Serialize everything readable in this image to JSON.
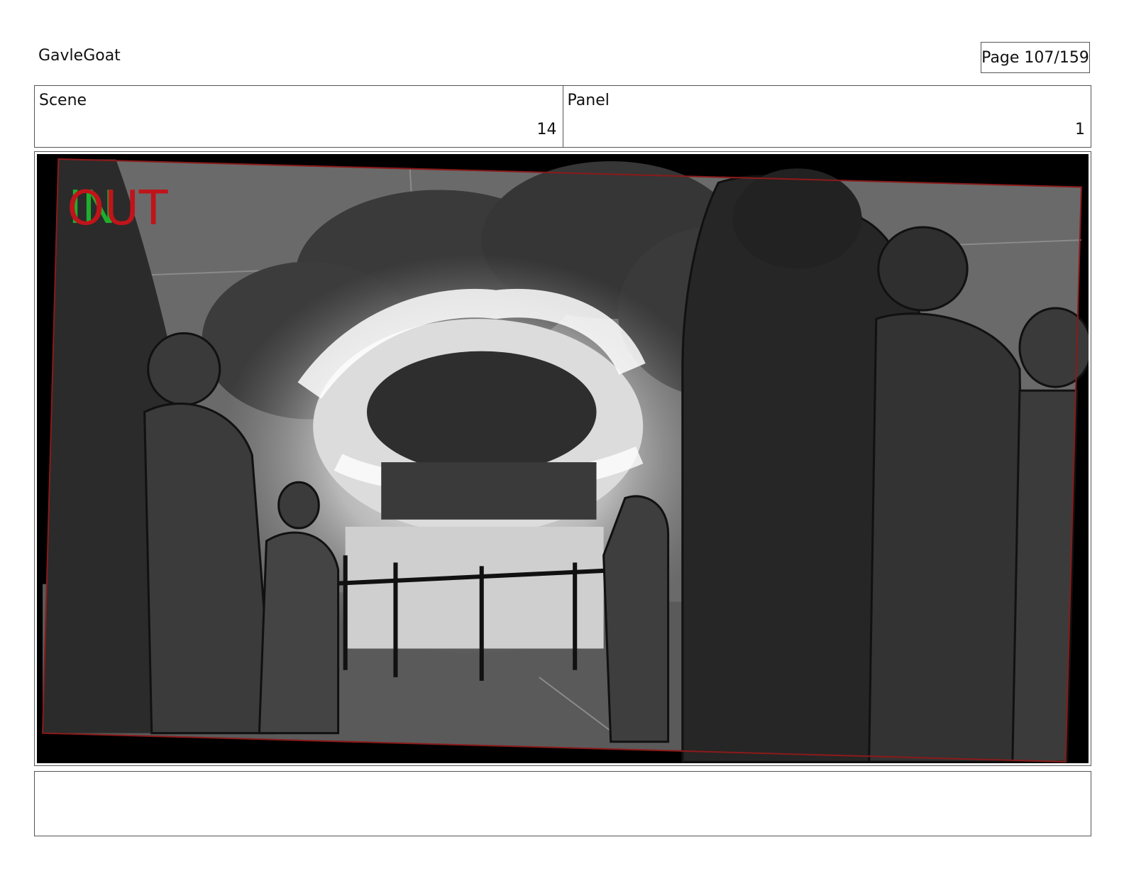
{
  "header": {
    "project_title": "GavleGoat",
    "page_label": "Page 107/159"
  },
  "info": {
    "scene_label": "Scene",
    "scene_number": "14",
    "panel_label": "Panel",
    "panel_number": "1"
  },
  "panel": {
    "overlay_in": "IN",
    "overlay_out": "OUT",
    "colors": {
      "overlay_out": "#c0141a",
      "overlay_in": "#1fae2e",
      "safe_frame": "#8b1a1a"
    }
  },
  "notes": {
    "text": ""
  }
}
